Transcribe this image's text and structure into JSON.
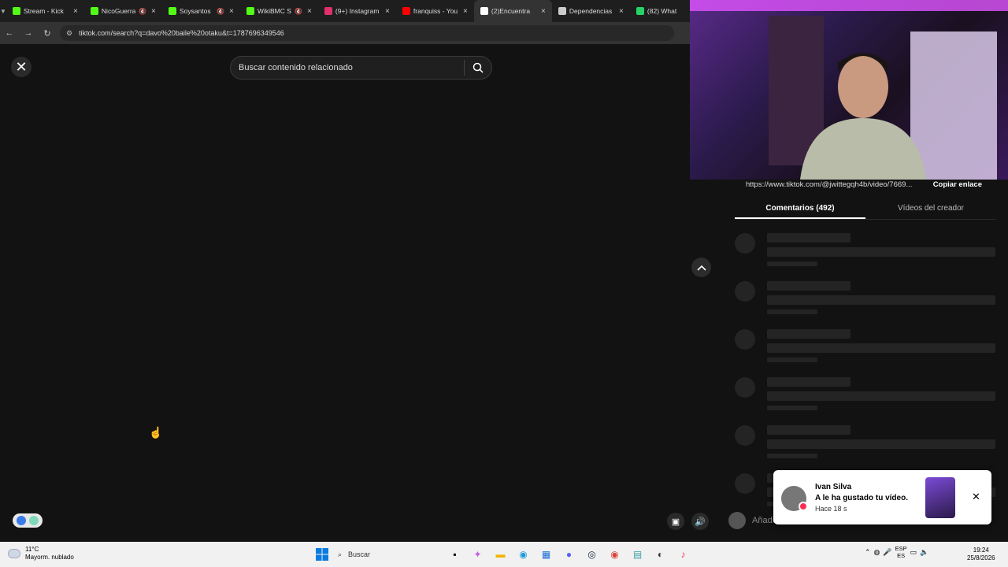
{
  "browser": {
    "tabs": [
      {
        "title": "Stream - Kick",
        "icon": "kick-icon",
        "color": "#53fc18",
        "muted": false
      },
      {
        "title": "NicoGuerra",
        "icon": "kick-icon",
        "color": "#53fc18",
        "muted": true
      },
      {
        "title": "Soysantos",
        "icon": "kick-icon",
        "color": "#53fc18",
        "muted": true
      },
      {
        "title": "WikiBMC S",
        "icon": "kick-icon",
        "color": "#53fc18",
        "muted": true
      },
      {
        "title": "(9+) Instagram",
        "icon": "instagram-icon",
        "color": "#e1306c",
        "muted": false
      },
      {
        "title": "franquiss - You",
        "icon": "youtube-icon",
        "color": "#ff0000",
        "muted": false
      },
      {
        "title": "(2)Encuentra",
        "icon": "tiktok-icon",
        "color": "#ffffff",
        "muted": false,
        "active": true
      },
      {
        "title": "Dependencias",
        "icon": "globe-icon",
        "color": "#cccccc",
        "muted": false
      },
      {
        "title": "(82) What",
        "icon": "whatsapp-icon",
        "color": "#25d366",
        "muted": false
      }
    ],
    "url": "tiktok.com/search?q=davo%20baile%20otaku&t=1787696349546"
  },
  "page": {
    "search_placeholder": "Buscar contenido relacionado"
  },
  "panel": {
    "share_url": "https://www.tiktok.com/@jwittegqh4b/video/7669...",
    "copy_link": "Copiar enlace",
    "tab_comments": "Comentarios (492)",
    "tab_creator": "Vídeos del creador",
    "comment_placeholder": "Añadir comentario..."
  },
  "notification": {
    "name": "Ivan Silva",
    "message": "A le ha gustado tu vídeo.",
    "time": "Hace 18 s"
  },
  "taskbar": {
    "temp": "11°C",
    "weather": "Mayorm. nublado",
    "search": "Buscar",
    "lang_top": "ESP",
    "lang_bottom": "ES",
    "time": "19:24",
    "date": "25/8/2026"
  }
}
